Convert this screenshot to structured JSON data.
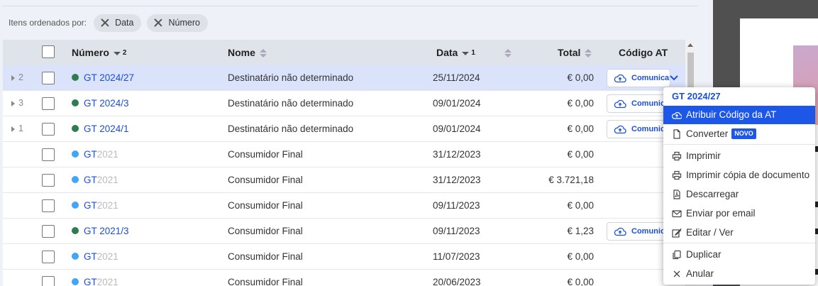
{
  "filters": {
    "label": "Itens ordenados por:",
    "chips": [
      "Data",
      "Número"
    ]
  },
  "table": {
    "columns": {
      "numero": "Número",
      "numero_sort": "2",
      "nome": "Nome",
      "data": "Data",
      "data_sort": "1",
      "total": "Total",
      "codigo_at": "Código AT"
    },
    "at_button_label": "Comunicar",
    "colors": {
      "green": "#2e7d4f",
      "blue": "#42a5f5",
      "link": "#1a4fd6",
      "selected_row": "#dbe3fb"
    },
    "rows": [
      {
        "expander": "2",
        "dot": "green",
        "num_a": "GT 2024/27",
        "num_b": "",
        "nome": "Destinatário não determinado",
        "data": "25/11/2024",
        "total": "€ 0,00",
        "at": true,
        "selected": true
      },
      {
        "expander": "3",
        "dot": "green",
        "num_a": "GT 2024/3",
        "num_b": "",
        "nome": "Destinatário não determinado",
        "data": "09/01/2024",
        "total": "€ 0,00",
        "at": true
      },
      {
        "expander": "1",
        "dot": "green",
        "num_a": "GT 2024/1",
        "num_b": "",
        "nome": "Destinatário não determinado",
        "data": "09/01/2024",
        "total": "€ 0,00",
        "at": true
      },
      {
        "expander": "",
        "dot": "blue",
        "num_a": "GT",
        "num_b": "2021",
        "nome": "Consumidor Final",
        "data": "31/12/2023",
        "total": "€ 0,00",
        "at": false
      },
      {
        "expander": "",
        "dot": "blue",
        "num_a": "GT",
        "num_b": "2021",
        "nome": "Consumidor Final",
        "data": "31/12/2023",
        "total": "€ 3.721,18",
        "at": false
      },
      {
        "expander": "",
        "dot": "blue",
        "num_a": "GT",
        "num_b": "2021",
        "nome": "Consumidor Final",
        "data": "09/11/2023",
        "total": "€ 0,00",
        "at": false
      },
      {
        "expander": "",
        "dot": "green",
        "num_a": "GT 2021/3",
        "num_b": "",
        "nome": "Consumidor Final",
        "data": "09/11/2023",
        "total": "€ 1,23",
        "at": true
      },
      {
        "expander": "",
        "dot": "blue",
        "num_a": "GT",
        "num_b": "2021",
        "nome": "Consumidor Final",
        "data": "11/07/2023",
        "total": "€ 0,00",
        "at": false
      },
      {
        "expander": "",
        "dot": "blue",
        "num_a": "GT",
        "num_b": "2021",
        "nome": "Consumidor Final",
        "data": "20/06/2023",
        "total": "€ 0,00",
        "at": false
      }
    ]
  },
  "context_menu": {
    "title": "GT 2024/27",
    "items": [
      {
        "label": "Atribuir Código da AT",
        "icon": "cloud-upload-icon",
        "active": true
      },
      {
        "label": "Converter",
        "icon": "document-icon",
        "badge": "NOVO"
      },
      {
        "label": "Imprimir",
        "icon": "printer-icon"
      },
      {
        "label": "Imprimir cópia de documento",
        "icon": "printer-icon"
      },
      {
        "label": "Descarregar",
        "icon": "pdf-icon"
      },
      {
        "label": "Enviar por email",
        "icon": "envelope-icon"
      },
      {
        "label": "Editar / Ver",
        "icon": "edit-icon"
      },
      {
        "label": "Duplicar",
        "icon": "copy-icon"
      },
      {
        "label": "Anular",
        "icon": "close-icon"
      }
    ]
  }
}
